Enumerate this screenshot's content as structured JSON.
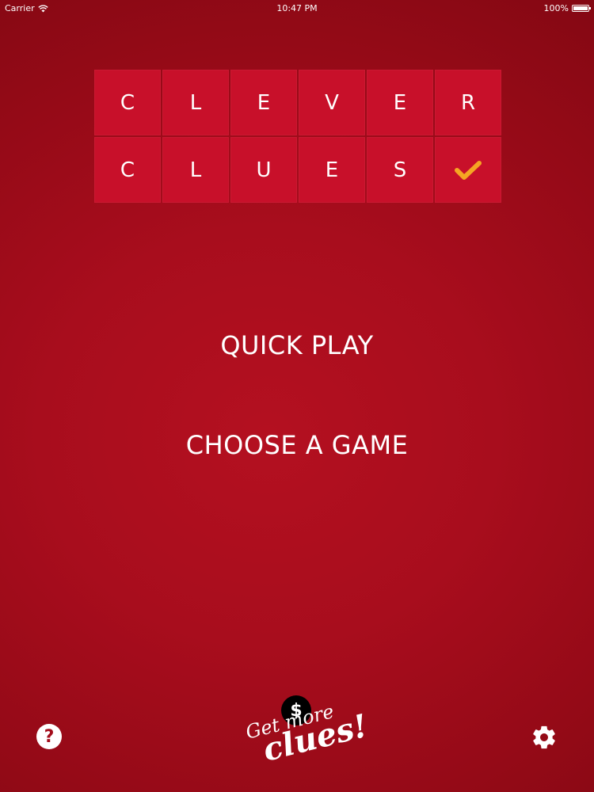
{
  "status_bar": {
    "carrier": "Carrier",
    "time": "10:47 PM",
    "battery": "100%"
  },
  "logo": {
    "row1": [
      "C",
      "L",
      "E",
      "V",
      "E",
      "R"
    ],
    "row2": [
      "C",
      "L",
      "U",
      "E",
      "S"
    ],
    "check_icon": "checkmark-icon",
    "check_color": "#f5a623",
    "tile_color": "#c8102a"
  },
  "menu": {
    "quick_play": "QUICK PLAY",
    "choose_game": "CHOOSE A GAME"
  },
  "bottom": {
    "help_symbol": "?",
    "help_icon": "help-icon",
    "settings_icon": "gear-icon",
    "coin_symbol": "$",
    "get_more_line1": "Get more",
    "get_more_line2": "clues!"
  }
}
